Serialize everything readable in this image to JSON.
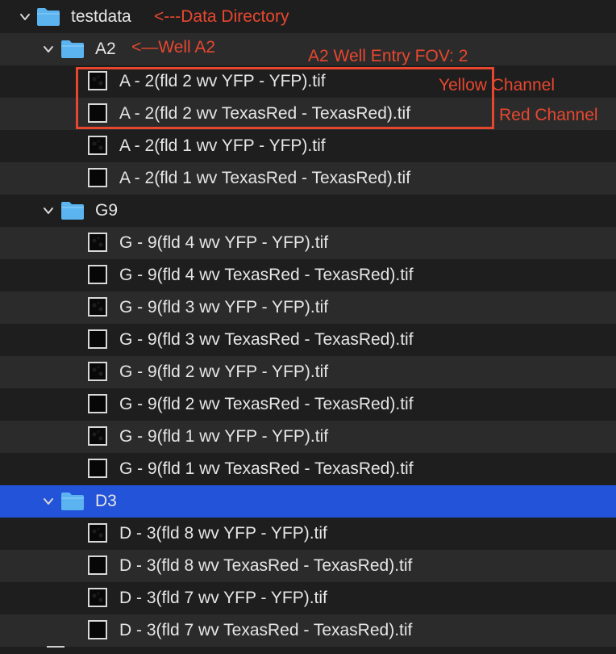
{
  "tree": {
    "root": {
      "label": "testdata",
      "expanded": true,
      "icon": "folder-icon"
    },
    "folders": [
      {
        "label": "A2",
        "expanded": true,
        "files": [
          "A - 2(fld 2 wv YFP - YFP).tif",
          "A - 2(fld 2 wv TexasRed - TexasRed).tif",
          "A - 2(fld 1 wv YFP - YFP).tif",
          "A - 2(fld 1 wv TexasRed - TexasRed).tif"
        ]
      },
      {
        "label": "G9",
        "expanded": true,
        "files": [
          "G - 9(fld 4 wv YFP - YFP).tif",
          "G - 9(fld 4 wv TexasRed - TexasRed).tif",
          "G - 9(fld 3 wv YFP - YFP).tif",
          "G - 9(fld 3 wv TexasRed - TexasRed).tif",
          "G - 9(fld 2 wv YFP - YFP).tif",
          "G - 9(fld 2 wv TexasRed - TexasRed).tif",
          "G - 9(fld 1 wv YFP - YFP).tif",
          "G - 9(fld 1 wv TexasRed - TexasRed).tif"
        ]
      },
      {
        "label": "D3",
        "expanded": true,
        "selected": true,
        "files": [
          "D - 3(fld 8 wv YFP - YFP).tif",
          "D - 3(fld 8 wv TexasRed - TexasRed).tif",
          "D - 3(fld 7 wv YFP - YFP).tif",
          "D - 3(fld 7 wv TexasRed - TexasRed).tif"
        ]
      }
    ]
  },
  "annotations": {
    "data_directory": "<---Data Directory",
    "well_a2": "<—Well A2",
    "entry_fov": "A2 Well Entry FOV: 2",
    "yellow_channel": "Yellow Channel",
    "red_channel": "Red Channel"
  },
  "colors": {
    "annotation": "#e8472f",
    "selection": "#2353d8",
    "folder": "#5bb4f0"
  }
}
